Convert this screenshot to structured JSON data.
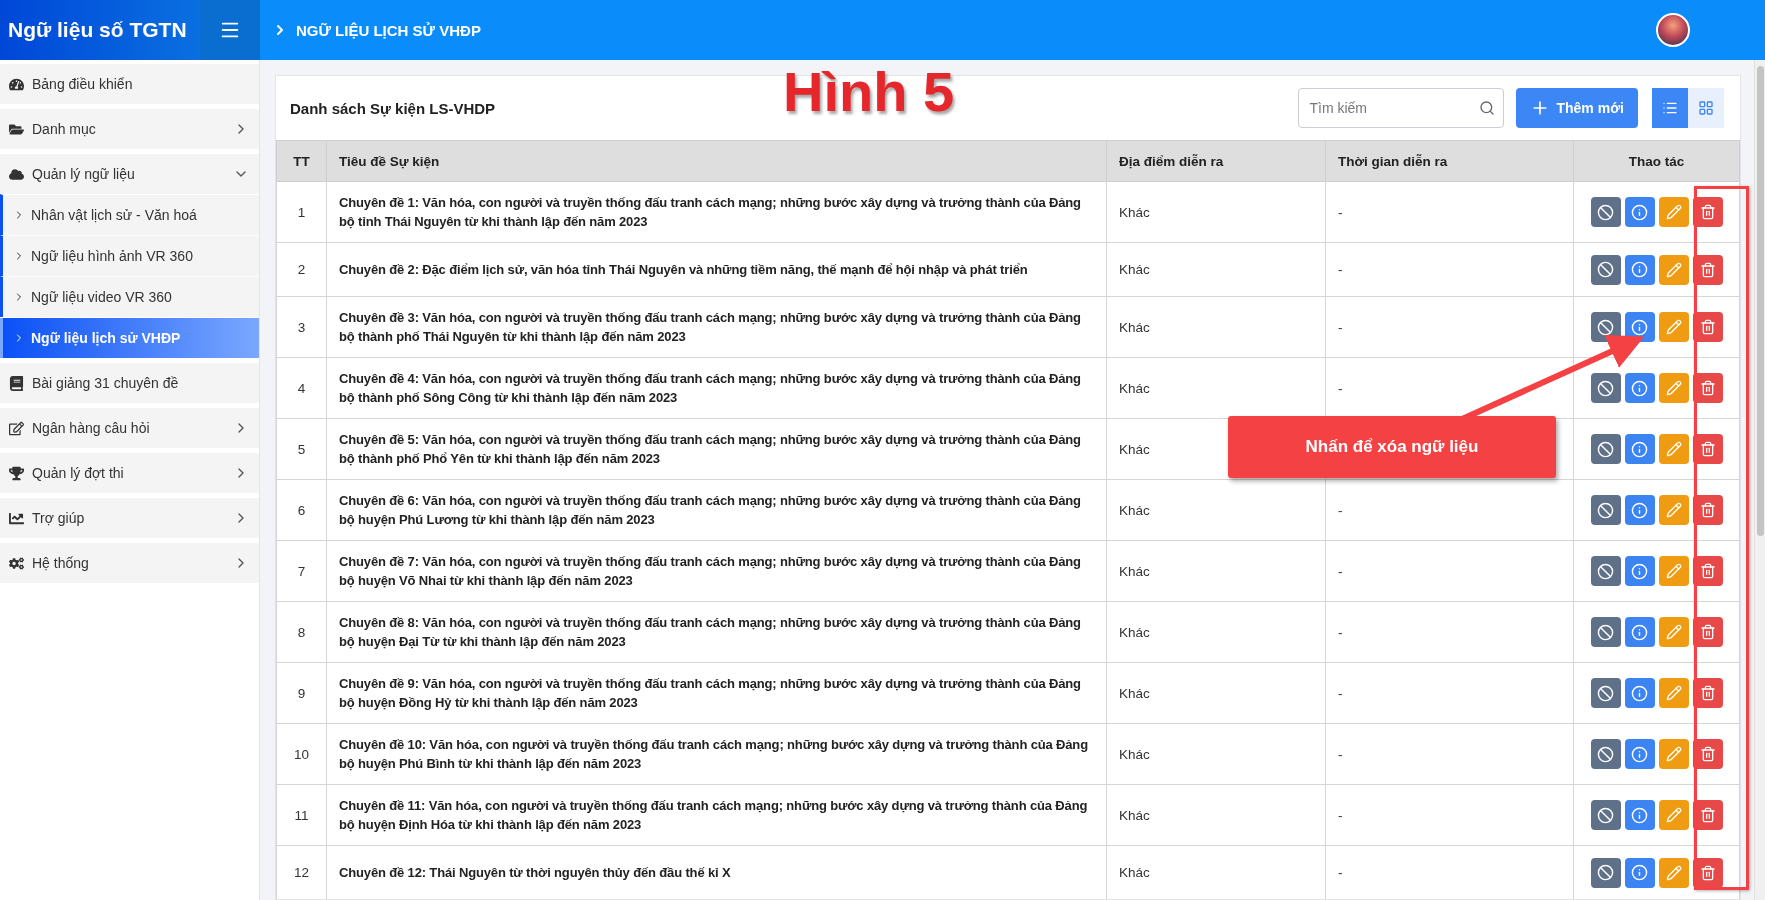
{
  "app_title": "Ngữ liệu số TGTN",
  "breadcrumb": "NGỮ LIỆU LỊCH SỬ VHĐP",
  "sidebar": {
    "items": [
      {
        "label": "Bảng điều khiển",
        "kind": "link",
        "selected": false
      },
      {
        "label": "Danh mục",
        "kind": "menu",
        "expanded": false,
        "selected": false
      },
      {
        "label": "Quản lý ngữ liệu",
        "kind": "menu",
        "expanded": true,
        "selected": false,
        "children": [
          {
            "label": "Nhân vật lịch sử - Văn hoá",
            "selected": false
          },
          {
            "label": "Ngữ liệu hình ảnh VR 360",
            "selected": false
          },
          {
            "label": "Ngữ liệu video VR 360",
            "selected": false
          },
          {
            "label": "Ngữ liệu lịch sử VHĐP",
            "selected": true
          }
        ]
      },
      {
        "label": "Bài giảng 31 chuyên đề",
        "kind": "link",
        "selected": false
      },
      {
        "label": "Ngân hàng câu hỏi",
        "kind": "menu",
        "expanded": false,
        "selected": false
      },
      {
        "label": "Quản lý đợt thi",
        "kind": "menu",
        "expanded": false,
        "selected": false
      },
      {
        "label": "Trợ giúp",
        "kind": "menu",
        "expanded": false,
        "selected": false
      },
      {
        "label": "Hệ thống",
        "kind": "menu",
        "expanded": false,
        "selected": false
      }
    ]
  },
  "card": {
    "title": "Danh sách Sự kiện LS-VHDP",
    "search": {
      "placeholder": "Tìm kiếm"
    },
    "add_button": "Thêm mới",
    "view_toggles": [
      {
        "kind": "list",
        "selected": true
      },
      {
        "kind": "grid",
        "selected": false
      }
    ]
  },
  "table": {
    "columns": [
      "TT",
      "Tiêu đề Sự kiện",
      "Địa điểm diễn ra",
      "Thời gian diễn ra",
      "Thao tác"
    ],
    "rows": [
      {
        "tt": "1",
        "title": "Chuyên đề 1: Văn hóa, con người và truyền thống đấu tranh cách mạng; những bước xây dựng và trưởng thành của Đảng bộ tỉnh Thái Nguyên từ khi thành lập đến năm 2023",
        "place": "Khác",
        "time": "-"
      },
      {
        "tt": "2",
        "title": "Chuyên đề 2: Đặc điểm lịch sử, văn hóa tỉnh Thái Nguyên và những tiềm năng, thế mạnh để hội nhập và phát triển",
        "place": "Khác",
        "time": "-"
      },
      {
        "tt": "3",
        "title": "Chuyên đề 3: Văn hóa, con người và truyền thống đấu tranh cách mạng; những bước xây dựng và trưởng thành của Đảng bộ thành phố Thái Nguyên từ khi thành lập đến năm 2023",
        "place": "Khác",
        "time": "-"
      },
      {
        "tt": "4",
        "title": "Chuyên đề 4: Văn hóa, con người và truyền thống đấu tranh cách mạng; những bước xây dựng và trưởng thành của Đảng bộ thành phố Sông Công từ khi thành lập đến năm 2023",
        "place": "Khác",
        "time": "-"
      },
      {
        "tt": "5",
        "title": "Chuyên đề 5: Văn hóa, con người và truyền thống đấu tranh cách mạng; những bước xây dựng và trưởng thành của Đảng bộ thành phố Phổ Yên từ khi thành lập đến năm 2023",
        "place": "Khác"
      },
      {
        "tt": "6",
        "title": "Chuyên đề 6: Văn hóa, con người và truyền thống đấu tranh cách mạng; những bước xây dựng và trưởng thành của Đảng bộ huyện Phú Lương từ khi thành lập đến năm 2023",
        "place": "Khác",
        "time": "-"
      },
      {
        "tt": "7",
        "title": "Chuyên đề 7: Văn hóa, con người và truyền thống đấu tranh cách mạng; những bước xây dựng và trưởng thành của Đảng bộ huyện Võ Nhai từ khi thành lập đến năm 2023",
        "place": "Khác",
        "time": "-"
      },
      {
        "tt": "8",
        "title": "Chuyên đề 8: Văn hóa, con người và truyền thống đấu tranh cách mạng; những bước xây dựng và trưởng thành của Đảng bộ huyện Đại Từ từ khi thành lập đến năm 2023",
        "place": "Khác",
        "time": "-"
      },
      {
        "tt": "9",
        "title": "Chuyên đề 9: Văn hóa, con người và truyền thống đấu tranh cách mạng; những bước xây dựng và trưởng thành của Đảng bộ huyện Đồng Hỷ từ khi thành lập đến năm 2023",
        "place": "Khác",
        "time": "-"
      },
      {
        "tt": "10",
        "title": "Chuyên đề 10: Văn hóa, con người và truyền thống đấu tranh cách mạng; những bước xây dựng và trưởng thành của Đảng bộ huyện Phú Bình từ khi thành lập đến năm 2023",
        "place": "Khác",
        "time": "-"
      },
      {
        "tt": "11",
        "title": "Chuyên đề 11: Văn hóa, con người và truyền thống đấu tranh cách mạng; những bước xây dựng và trưởng thành của Đảng bộ huyện Định Hóa từ khi thành lập đến năm 2023",
        "place": "Khác",
        "time": "-"
      },
      {
        "tt": "12",
        "title": "Chuyên đề 12: Thái Nguyên từ thời nguyên thủy đến đầu thế kỉ X",
        "place": "Khác",
        "time": "-"
      }
    ]
  },
  "annotation": {
    "figure_label": "Hình 5",
    "callout": "Nhấn để xóa ngữ liệu"
  }
}
